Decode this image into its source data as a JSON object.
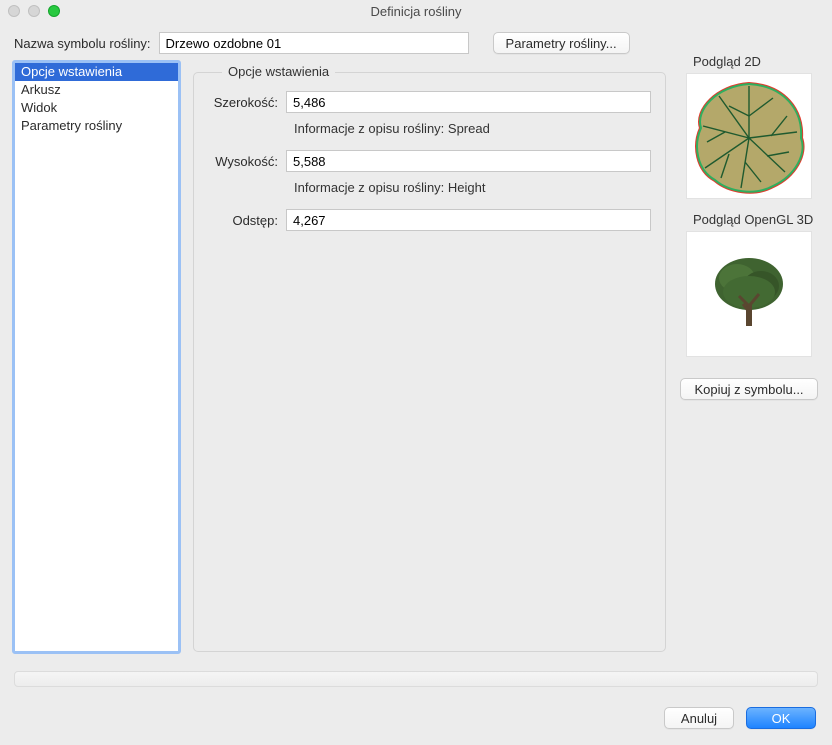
{
  "window": {
    "title": "Definicja rośliny"
  },
  "topbar": {
    "name_label": "Nazwa symbolu rośliny:",
    "name_value": "Drzewo ozdobne 01",
    "params_button": "Parametry rośliny..."
  },
  "sidebar": {
    "items": [
      {
        "label": "Opcje wstawienia",
        "selected": true
      },
      {
        "label": "Arkusz",
        "selected": false
      },
      {
        "label": "Widok",
        "selected": false
      },
      {
        "label": "Parametry rośliny",
        "selected": false
      }
    ]
  },
  "group": {
    "title": "Opcje wstawienia",
    "width_label": "Szerokość:",
    "width_value": "5,486",
    "width_info": "Informacje z opisu rośliny: Spread",
    "height_label": "Wysokość:",
    "height_value": "5,588",
    "height_info": "Informacje z opisu rośliny: Height",
    "spacing_label": "Odstęp:",
    "spacing_value": "4,267"
  },
  "previews": {
    "p2d_title": "Podgląd 2D",
    "p3d_title": "Podgląd OpenGL 3D",
    "copy_button": "Kopiuj z symbolu..."
  },
  "footer": {
    "cancel": "Anuluj",
    "ok": "OK"
  }
}
